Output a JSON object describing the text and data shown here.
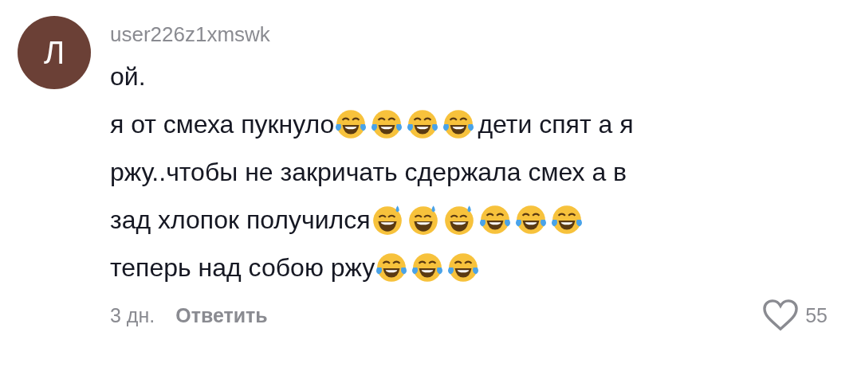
{
  "comment": {
    "avatar_letter": "Л",
    "username": "user226z1xmswk",
    "lines": [
      [
        {
          "kind": "text",
          "text": "ой."
        }
      ],
      [
        {
          "kind": "text",
          "text": "я от смеха пукнуло"
        },
        {
          "kind": "tears"
        },
        {
          "kind": "tears"
        },
        {
          "kind": "tears"
        },
        {
          "kind": "tears"
        },
        {
          "kind": "text",
          "text": "дети спят а я"
        }
      ],
      [
        {
          "kind": "text",
          "text": "ржу..чтобы не закричать сдержала смех а в"
        }
      ],
      [
        {
          "kind": "text",
          "text": "зад хлопок получился"
        },
        {
          "kind": "sweat"
        },
        {
          "kind": "sweat"
        },
        {
          "kind": "sweat"
        },
        {
          "kind": "tears"
        },
        {
          "kind": "tears"
        },
        {
          "kind": "tears"
        }
      ],
      [
        {
          "kind": "text",
          "text": "теперь над собою ржу"
        },
        {
          "kind": "tears"
        },
        {
          "kind": "tears"
        },
        {
          "kind": "tears"
        }
      ]
    ],
    "time": "3 дн.",
    "reply": "Ответить",
    "liked": false,
    "likes": "55"
  }
}
